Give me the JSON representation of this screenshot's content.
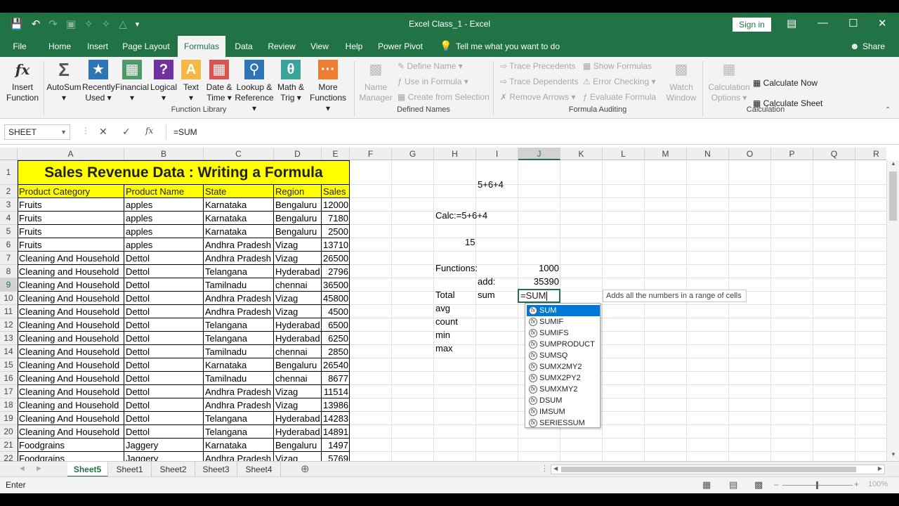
{
  "window": {
    "title": "Excel Class_1  -  Excel",
    "sign_in": "Sign in"
  },
  "menu": [
    "File",
    "Home",
    "Insert",
    "Page Layout",
    "Formulas",
    "Data",
    "Review",
    "View",
    "Help",
    "Power Pivot"
  ],
  "tell_me": "Tell me what you want to do",
  "share": "Share",
  "ribbon": {
    "insert_function": [
      "Insert",
      "Function"
    ],
    "library": [
      [
        "AutoSum",
        "▾"
      ],
      [
        "Recently",
        "Used ▾"
      ],
      [
        "Financial",
        "▾"
      ],
      [
        "Logical",
        "▾"
      ],
      [
        "Text",
        "▾"
      ],
      [
        "Date &",
        "Time ▾"
      ],
      [
        "Lookup &",
        "Reference ▾"
      ],
      [
        "Math &",
        "Trig ▾"
      ],
      [
        "More",
        "Functions ▾"
      ]
    ],
    "group_library": "Function Library",
    "name_manager": [
      "Name",
      "Manager"
    ],
    "defined": [
      "Define Name ▾",
      "Use in Formula ▾",
      "Create from Selection"
    ],
    "group_defined": "Defined Names",
    "auditing": [
      "Trace Precedents",
      "Trace Dependents",
      "Remove Arrows ▾",
      "Show Formulas",
      "Error Checking ▾",
      "Evaluate Formula"
    ],
    "watch": [
      "Watch",
      "Window"
    ],
    "group_auditing": "Formula Auditing",
    "calc_options": [
      "Calculation",
      "Options ▾"
    ],
    "calc_now": "Calculate Now",
    "calc_sheet": "Calculate Sheet",
    "group_calc": "Calculation"
  },
  "formula_bar": {
    "name_box": "SHEET",
    "content": "=SUM"
  },
  "columns": [
    "A",
    "B",
    "C",
    "D",
    "E",
    "F",
    "G",
    "H",
    "I",
    "J",
    "K",
    "L",
    "M",
    "N",
    "O",
    "P",
    "Q",
    "R"
  ],
  "rows": [
    "1",
    "2",
    "3",
    "4",
    "5",
    "6",
    "7",
    "8",
    "9",
    "10",
    "11",
    "12",
    "13",
    "14",
    "15",
    "16",
    "17",
    "18",
    "19",
    "20",
    "21",
    "22"
  ],
  "sheet_title": "Sales Revenue Data : Writing a Formula",
  "table_headers": [
    "Product Category",
    "Product Name",
    "State",
    "Region",
    "Sales"
  ],
  "table_rows": [
    [
      "Fruits",
      "apples",
      "Karnataka",
      "Bengaluru",
      "12000"
    ],
    [
      "Fruits",
      "apples",
      "Karnataka",
      "Bengaluru",
      "7180"
    ],
    [
      "Fruits",
      "apples",
      "Karnataka",
      "Bengaluru",
      "2500"
    ],
    [
      "Fruits",
      "apples",
      "Andhra Pradesh",
      "Vizag",
      "13710"
    ],
    [
      "Cleaning And Household",
      "Dettol",
      "Andhra Pradesh",
      "Vizag",
      "26500"
    ],
    [
      "Cleaning and Household",
      "Dettol",
      "Telangana",
      "Hyderabad",
      "2796"
    ],
    [
      "Cleaning And Household",
      "Dettol",
      "Tamilnadu",
      "chennai",
      "36500"
    ],
    [
      "Cleaning And Household",
      "Dettol",
      "Andhra Pradesh",
      "Vizag",
      "45800"
    ],
    [
      "Cleaning And Household",
      "Dettol",
      "Andhra Pradesh",
      "Vizag",
      "4500"
    ],
    [
      "Cleaning And Household",
      "Dettol",
      "Telangana",
      "Hyderabad",
      "6500"
    ],
    [
      "Cleaning and Household",
      "Dettol",
      "Telangana",
      "Hyderabad",
      "6250"
    ],
    [
      "Cleaning And Household",
      "Dettol",
      "Tamilnadu",
      "chennai",
      "2850"
    ],
    [
      "Cleaning And Household",
      "Dettol",
      "Karnataka",
      "Bengaluru",
      "26540"
    ],
    [
      "Cleaning And Household",
      "Dettol",
      "Tamilnadu",
      "chennai",
      "8677"
    ],
    [
      "Cleaning And Household",
      "Dettol",
      "Andhra Pradesh",
      "Vizag",
      "11514"
    ],
    [
      "Cleaning and Household",
      "Dettol",
      "Andhra Pradesh",
      "Vizag",
      "13986"
    ],
    [
      "Cleaning And Household",
      "Dettol",
      "Telangana",
      "Hyderabad",
      "14283"
    ],
    [
      "Cleaning And Household",
      "Dettol",
      "Telangana",
      "Hyderabad",
      "14891"
    ],
    [
      "Foodgrains",
      "Jaggery",
      "Karnataka",
      "Bengaluru",
      "1497"
    ],
    [
      "Foodgrains",
      "Jaggery",
      "Andhra Pradesh",
      "Vizag",
      "5769"
    ]
  ],
  "side": {
    "i1": "5+6+4",
    "h3": "Calc:=5+6+4",
    "h5": "15",
    "h7": "Functions:",
    "j7": "1000",
    "i8": "add:",
    "j8": "35390",
    "h9": "Total",
    "i9": "sum",
    "h10": "avg",
    "h11": "count",
    "h12": "min",
    "h13": "max"
  },
  "active_cell_text": "=SUM",
  "autocomplete": [
    "SUM",
    "SUMIF",
    "SUMIFS",
    "SUMPRODUCT",
    "SUMSQ",
    "SUMX2MY2",
    "SUMX2PY2",
    "SUMXMY2",
    "DSUM",
    "IMSUM",
    "SERIESSUM"
  ],
  "tooltip": "Adds all the numbers in a range of cells",
  "sheets": [
    "Sheet5",
    "Sheet1",
    "Sheet2",
    "Sheet3",
    "Sheet4"
  ],
  "status": {
    "mode": "Enter",
    "zoom": "100%"
  },
  "colors": {
    "excel_green": "#217346",
    "highlight_yellow": "#ffff00",
    "selection_blue": "#0078d7"
  }
}
